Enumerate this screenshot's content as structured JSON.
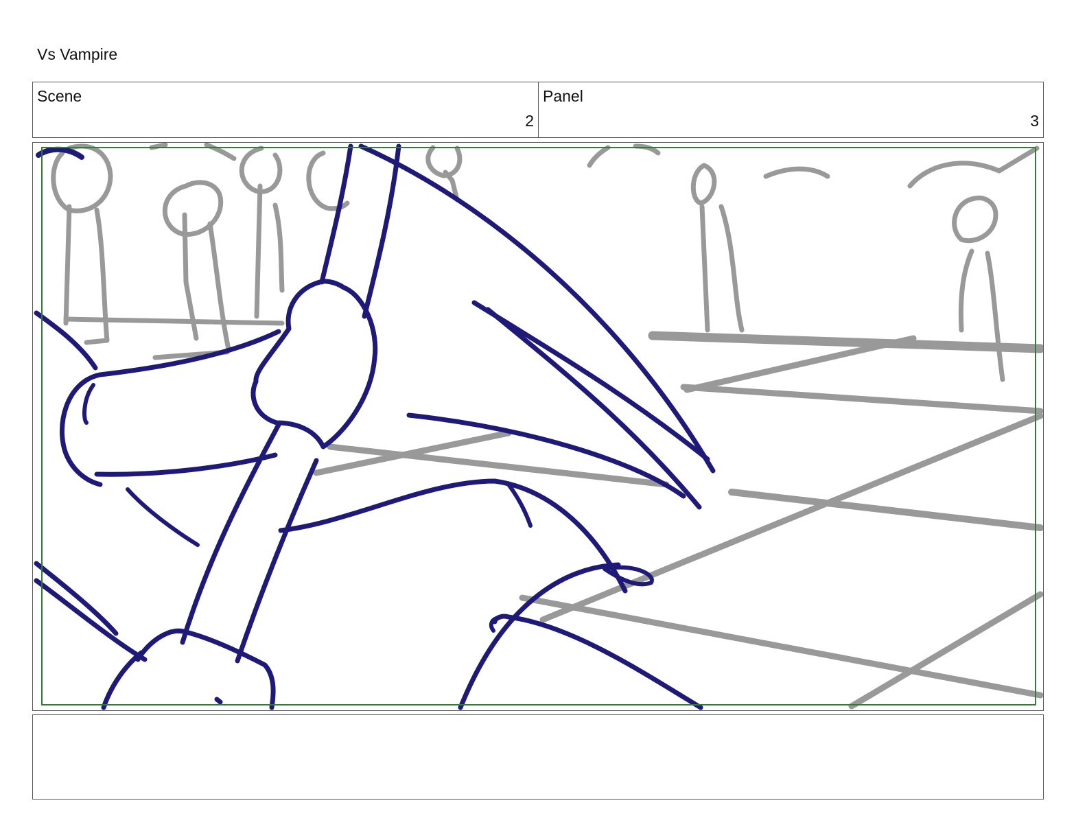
{
  "document": {
    "title": "Vs Vampire"
  },
  "header": {
    "scene_label": "Scene",
    "scene_value": "2",
    "panel_label": "Panel",
    "panel_value": "3"
  },
  "panel_drawing": {
    "description_colors": {
      "foreground_lines": "#1f1a78",
      "background_lines": "#999999",
      "safe_area_border": "#2e7d32"
    }
  },
  "notes": {
    "text": ""
  }
}
